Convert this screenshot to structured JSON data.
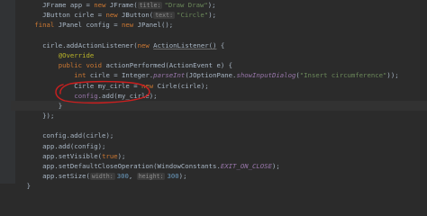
{
  "code": {
    "lines": [
      {
        "indent": "        ",
        "tokens": [
          {
            "t": "JFrame app = "
          },
          {
            "t": "new ",
            "c": "kw"
          },
          {
            "t": "JFrame("
          },
          {
            "t": "title:",
            "c": "hint"
          },
          {
            "t": "\"Draw Draw\"",
            "c": "str"
          },
          {
            "t": ");"
          }
        ]
      },
      {
        "indent": "        ",
        "tokens": [
          {
            "t": "JButton cirle = "
          },
          {
            "t": "new ",
            "c": "kw"
          },
          {
            "t": "JButton("
          },
          {
            "t": "text:",
            "c": "hint"
          },
          {
            "t": "\"Circle\"",
            "c": "str"
          },
          {
            "t": ");"
          }
        ]
      },
      {
        "indent": "      ",
        "tokens": [
          {
            "t": "final ",
            "c": "kw"
          },
          {
            "t": "JPanel config = "
          },
          {
            "t": "new ",
            "c": "kw"
          },
          {
            "t": "JPanel();"
          }
        ]
      },
      {
        "indent": "",
        "tokens": []
      },
      {
        "indent": "        ",
        "tokens": [
          {
            "t": "cirle.addActionListener("
          },
          {
            "t": "new ",
            "c": "kw"
          },
          {
            "t": "ActionListener()",
            "c": "u"
          },
          {
            "t": " {"
          }
        ]
      },
      {
        "indent": "            ",
        "tokens": [
          {
            "t": "@Override",
            "c": "ann"
          }
        ]
      },
      {
        "indent": "            ",
        "tokens": [
          {
            "t": "public ",
            "c": "kw"
          },
          {
            "t": "void ",
            "c": "kw"
          },
          {
            "t": "actionPerformed(ActionEvent e) {"
          }
        ]
      },
      {
        "indent": "                ",
        "tokens": [
          {
            "t": "int ",
            "c": "kw"
          },
          {
            "t": "cirle = Integer."
          },
          {
            "t": "parseInt",
            "c": "it"
          },
          {
            "t": "(JOptionPane."
          },
          {
            "t": "showInputDialog",
            "c": "it"
          },
          {
            "t": "(",
            "c": ""
          },
          {
            "t": "\"Insert circumference\"",
            "c": "str"
          },
          {
            "t": "));"
          }
        ]
      },
      {
        "indent": "                ",
        "tokens": [
          {
            "t": "Cirle my_cirle = "
          },
          {
            "t": "new ",
            "c": "kw"
          },
          {
            "t": "Cirle(cirle);"
          }
        ]
      },
      {
        "indent": "                ",
        "tokens": [
          {
            "t": "config",
            "c": "var"
          },
          {
            "t": ".add(my_cirle);"
          }
        ]
      },
      {
        "indent": "            ",
        "tokens": [
          {
            "t": "}"
          }
        ],
        "hl": true
      },
      {
        "indent": "        ",
        "tokens": [
          {
            "t": "});"
          }
        ]
      },
      {
        "indent": "",
        "tokens": []
      },
      {
        "indent": "        ",
        "tokens": [
          {
            "t": "config.add(cirle);"
          }
        ]
      },
      {
        "indent": "        ",
        "tokens": [
          {
            "t": "app.add(config);"
          }
        ]
      },
      {
        "indent": "        ",
        "tokens": [
          {
            "t": "app.setVisible("
          },
          {
            "t": "true",
            "c": "kw"
          },
          {
            "t": ");"
          }
        ]
      },
      {
        "indent": "        ",
        "tokens": [
          {
            "t": "app.setDefaultCloseOperation(WindowConstants."
          },
          {
            "t": "EXIT_ON_CLOSE",
            "c": "it"
          },
          {
            "t": ");"
          }
        ]
      },
      {
        "indent": "        ",
        "tokens": [
          {
            "t": "app.setSize("
          },
          {
            "t": "width:",
            "c": "hint"
          },
          {
            "t": "300",
            "c": "num"
          },
          {
            "t": ", "
          },
          {
            "t": "height:",
            "c": "hint"
          },
          {
            "t": "300",
            "c": "num"
          },
          {
            "t": ");"
          }
        ]
      },
      {
        "indent": "    ",
        "tokens": [
          {
            "t": "}"
          }
        ]
      }
    ]
  },
  "annotation": {
    "description": "red hand-drawn circle around config.add(my_cirle)",
    "color": "#cc1f1f"
  }
}
